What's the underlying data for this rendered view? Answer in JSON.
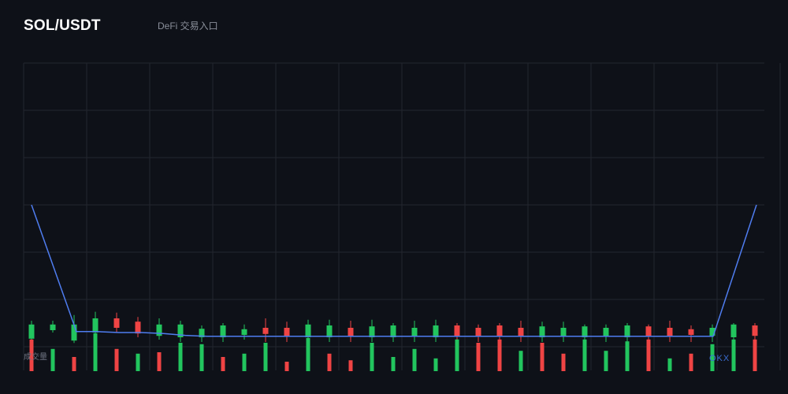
{
  "header": {
    "pair": "SOL/USDT",
    "subtitle": "DeFi 交易入口"
  },
  "chart_data": {
    "type": "candlestick",
    "volume_label": "成交量",
    "watermark": "OKX",
    "grid": true,
    "colors": {
      "up": "#22c55e",
      "down": "#ef4444",
      "line": "#4f7df0",
      "grid": "#23262f",
      "background": "#0e1118"
    },
    "ylim": [
      0,
      6
    ],
    "line_values": [
      3.0,
      0.32,
      0.32,
      0.32,
      0.3,
      0.3,
      0.28,
      0.24,
      0.22,
      0.22,
      0.22,
      0.22,
      0.22,
      0.22,
      0.22,
      0.22,
      0.22,
      0.22,
      0.22,
      0.22,
      0.22,
      0.22,
      0.22,
      0.22,
      0.22,
      0.22,
      0.22,
      0.22,
      0.22,
      0.22,
      0.22,
      0.22,
      0.22,
      3.0
    ],
    "candles": [
      {
        "o": 0.17,
        "c": 0.47,
        "h": 0.55,
        "l": 0.1,
        "dir": "up"
      },
      {
        "o": 0.35,
        "c": 0.47,
        "h": 0.55,
        "l": 0.3,
        "dir": "up"
      },
      {
        "o": 0.13,
        "c": 0.47,
        "h": 0.67,
        "l": 0.08,
        "dir": "up"
      },
      {
        "o": 0.3,
        "c": 0.6,
        "h": 0.74,
        "l": 0.2,
        "dir": "up"
      },
      {
        "o": 0.6,
        "c": 0.4,
        "h": 0.72,
        "l": 0.3,
        "dir": "down"
      },
      {
        "o": 0.53,
        "c": 0.28,
        "h": 0.63,
        "l": 0.2,
        "dir": "down"
      },
      {
        "o": 0.23,
        "c": 0.47,
        "h": 0.6,
        "l": 0.15,
        "dir": "up"
      },
      {
        "o": 0.2,
        "c": 0.47,
        "h": 0.55,
        "l": 0.1,
        "dir": "up"
      },
      {
        "o": 0.2,
        "c": 0.38,
        "h": 0.45,
        "l": 0.1,
        "dir": "up"
      },
      {
        "o": 0.2,
        "c": 0.45,
        "h": 0.5,
        "l": 0.1,
        "dir": "up"
      },
      {
        "o": 0.25,
        "c": 0.37,
        "h": 0.47,
        "l": 0.15,
        "dir": "up"
      },
      {
        "o": 0.4,
        "c": 0.27,
        "h": 0.6,
        "l": 0.1,
        "dir": "down"
      },
      {
        "o": 0.4,
        "c": 0.23,
        "h": 0.53,
        "l": 0.1,
        "dir": "down"
      },
      {
        "o": 0.2,
        "c": 0.47,
        "h": 0.57,
        "l": 0.1,
        "dir": "up"
      },
      {
        "o": 0.2,
        "c": 0.45,
        "h": 0.57,
        "l": 0.1,
        "dir": "up"
      },
      {
        "o": 0.4,
        "c": 0.23,
        "h": 0.55,
        "l": 0.1,
        "dir": "down"
      },
      {
        "o": 0.2,
        "c": 0.43,
        "h": 0.57,
        "l": 0.1,
        "dir": "up"
      },
      {
        "o": 0.2,
        "c": 0.45,
        "h": 0.5,
        "l": 0.1,
        "dir": "up"
      },
      {
        "o": 0.23,
        "c": 0.4,
        "h": 0.55,
        "l": 0.1,
        "dir": "up"
      },
      {
        "o": 0.2,
        "c": 0.45,
        "h": 0.57,
        "l": 0.1,
        "dir": "up"
      },
      {
        "o": 0.45,
        "c": 0.23,
        "h": 0.5,
        "l": 0.1,
        "dir": "down"
      },
      {
        "o": 0.4,
        "c": 0.23,
        "h": 0.47,
        "l": 0.1,
        "dir": "down"
      },
      {
        "o": 0.45,
        "c": 0.23,
        "h": 0.5,
        "l": 0.1,
        "dir": "down"
      },
      {
        "o": 0.4,
        "c": 0.23,
        "h": 0.55,
        "l": 0.1,
        "dir": "down"
      },
      {
        "o": 0.2,
        "c": 0.43,
        "h": 0.53,
        "l": 0.1,
        "dir": "up"
      },
      {
        "o": 0.23,
        "c": 0.4,
        "h": 0.53,
        "l": 0.1,
        "dir": "up"
      },
      {
        "o": 0.2,
        "c": 0.43,
        "h": 0.47,
        "l": 0.1,
        "dir": "up"
      },
      {
        "o": 0.23,
        "c": 0.4,
        "h": 0.47,
        "l": 0.1,
        "dir": "up"
      },
      {
        "o": 0.2,
        "c": 0.45,
        "h": 0.5,
        "l": 0.1,
        "dir": "up"
      },
      {
        "o": 0.43,
        "c": 0.23,
        "h": 0.47,
        "l": 0.1,
        "dir": "down"
      },
      {
        "o": 0.4,
        "c": 0.23,
        "h": 0.55,
        "l": 0.1,
        "dir": "down"
      },
      {
        "o": 0.37,
        "c": 0.25,
        "h": 0.45,
        "l": 0.1,
        "dir": "down"
      },
      {
        "o": 0.23,
        "c": 0.4,
        "h": 0.47,
        "l": 0.1,
        "dir": "up"
      },
      {
        "o": 0.2,
        "c": 0.47,
        "h": 0.5,
        "l": 0.1,
        "dir": "up"
      },
      {
        "o": 0.45,
        "c": 0.23,
        "h": 0.5,
        "l": 0.1,
        "dir": "down"
      }
    ],
    "volumes": [
      {
        "v": 0.67,
        "dir": "down"
      },
      {
        "v": 0.47,
        "dir": "up"
      },
      {
        "v": 0.3,
        "dir": "down"
      },
      {
        "v": 0.8,
        "dir": "up"
      },
      {
        "v": 0.47,
        "dir": "down"
      },
      {
        "v": 0.37,
        "dir": "up"
      },
      {
        "v": 0.4,
        "dir": "down"
      },
      {
        "v": 0.6,
        "dir": "up"
      },
      {
        "v": 0.57,
        "dir": "up"
      },
      {
        "v": 0.3,
        "dir": "down"
      },
      {
        "v": 0.37,
        "dir": "up"
      },
      {
        "v": 0.6,
        "dir": "up"
      },
      {
        "v": 0.2,
        "dir": "down"
      },
      {
        "v": 0.7,
        "dir": "up"
      },
      {
        "v": 0.37,
        "dir": "down"
      },
      {
        "v": 0.23,
        "dir": "down"
      },
      {
        "v": 0.6,
        "dir": "up"
      },
      {
        "v": 0.3,
        "dir": "up"
      },
      {
        "v": 0.47,
        "dir": "up"
      },
      {
        "v": 0.27,
        "dir": "up"
      },
      {
        "v": 0.67,
        "dir": "up"
      },
      {
        "v": 0.6,
        "dir": "down"
      },
      {
        "v": 0.67,
        "dir": "down"
      },
      {
        "v": 0.43,
        "dir": "up"
      },
      {
        "v": 0.6,
        "dir": "down"
      },
      {
        "v": 0.37,
        "dir": "down"
      },
      {
        "v": 0.67,
        "dir": "up"
      },
      {
        "v": 0.43,
        "dir": "up"
      },
      {
        "v": 0.63,
        "dir": "up"
      },
      {
        "v": 0.67,
        "dir": "down"
      },
      {
        "v": 0.27,
        "dir": "up"
      },
      {
        "v": 0.37,
        "dir": "down"
      },
      {
        "v": 0.57,
        "dir": "up"
      },
      {
        "v": 0.67,
        "dir": "up"
      },
      {
        "v": 0.67,
        "dir": "down"
      }
    ]
  }
}
